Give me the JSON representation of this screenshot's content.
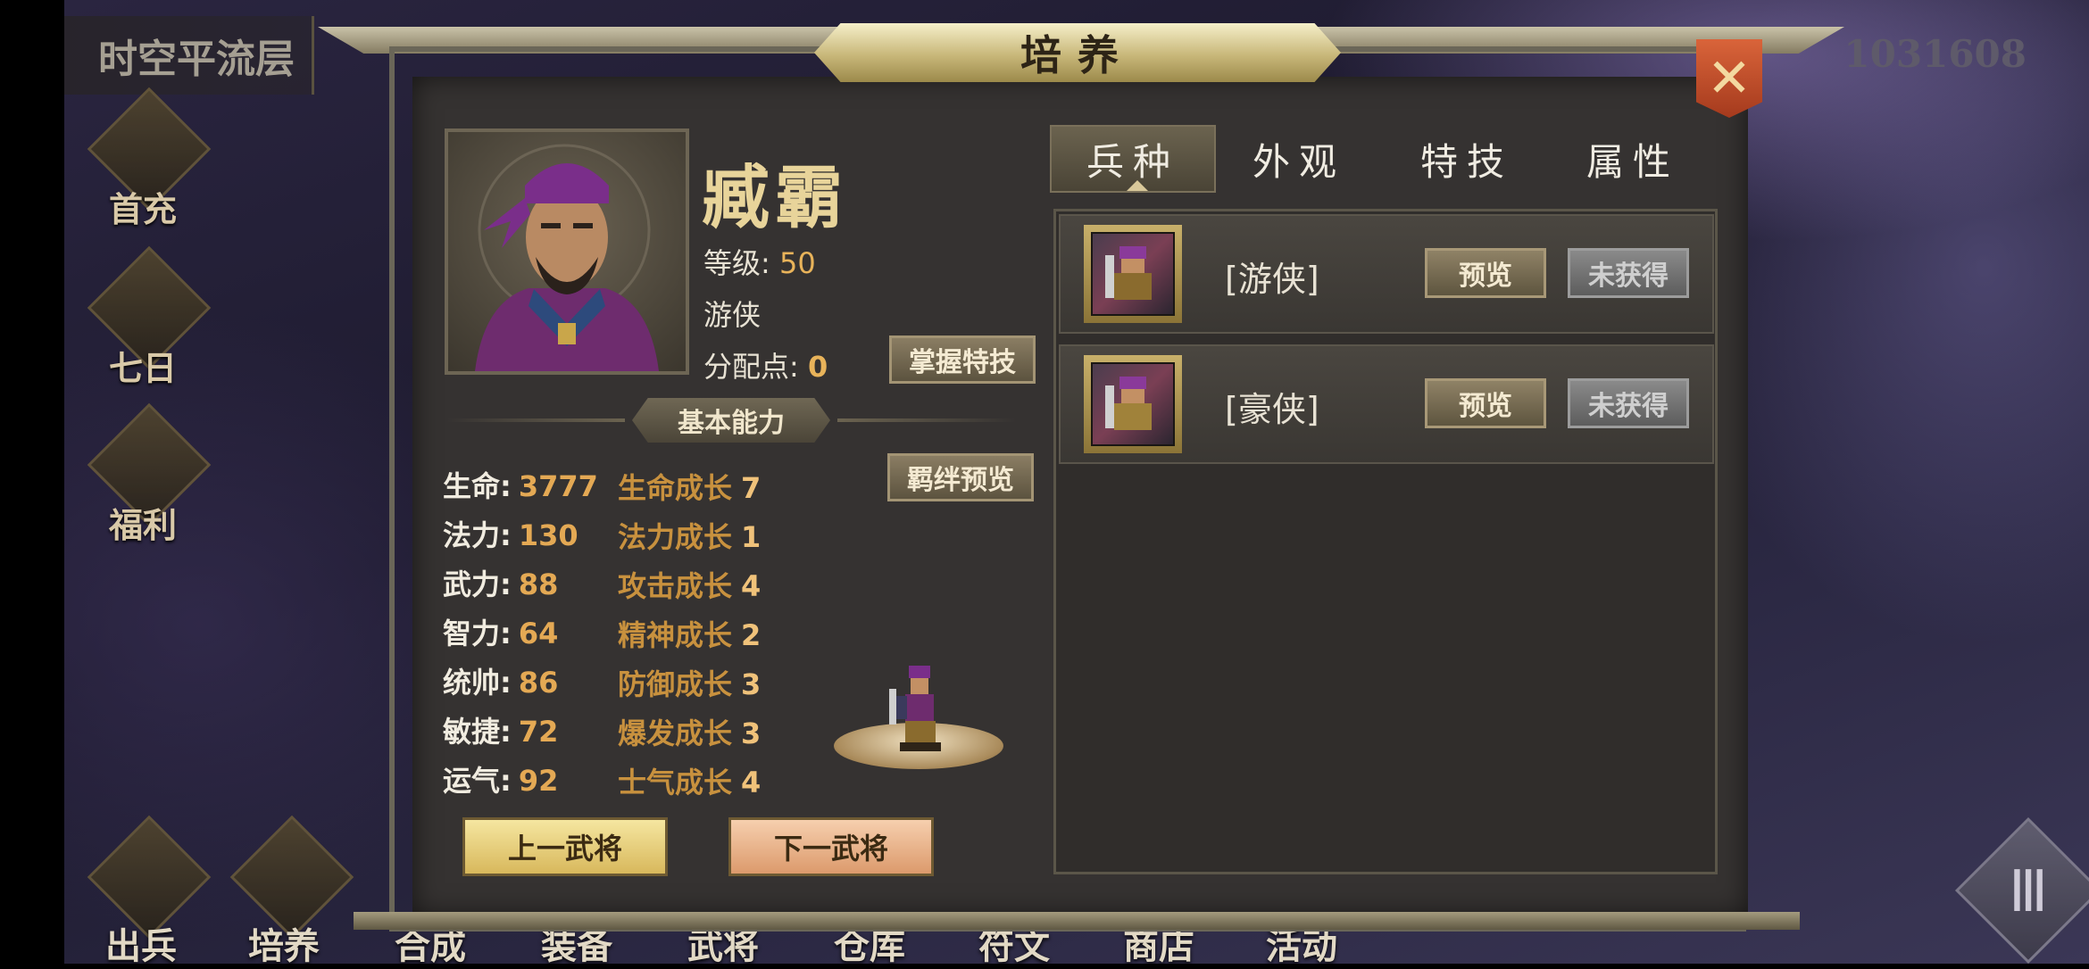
{
  "location": "时空平流层",
  "score": "1031608",
  "side_menu": [
    {
      "label": "首充",
      "icon": "gift-icon"
    },
    {
      "label": "七日",
      "icon": "scroll-icon"
    },
    {
      "label": "福利",
      "icon": "treasure-chest-icon"
    }
  ],
  "bottom_nav": [
    "出兵",
    "培养",
    "合成",
    "装备",
    "武将",
    "仓库",
    "符文",
    "商店",
    "活动"
  ],
  "dialog": {
    "title": "培养",
    "close_icon": "close-icon"
  },
  "hero": {
    "name": "臧霸",
    "level_label": "等级:",
    "level": "50",
    "class": "游侠",
    "points_label": "分配点:",
    "points": "0",
    "master_skill_button": "掌握特技",
    "bond_preview_button": "羁绊预览",
    "section_title": "基本能力",
    "stats": [
      {
        "label": "生命:",
        "value": "3777"
      },
      {
        "label": "法力:",
        "value": "130"
      },
      {
        "label": "武力:",
        "value": "88"
      },
      {
        "label": "智力:",
        "value": "64"
      },
      {
        "label": "统帅:",
        "value": "86"
      },
      {
        "label": "敏捷:",
        "value": "72"
      },
      {
        "label": "运气:",
        "value": "92"
      }
    ],
    "growth": [
      {
        "label": "生命成长",
        "value": "7"
      },
      {
        "label": "法力成长",
        "value": "1"
      },
      {
        "label": "攻击成长",
        "value": "4"
      },
      {
        "label": "精神成长",
        "value": "2"
      },
      {
        "label": "防御成长",
        "value": "3"
      },
      {
        "label": "爆发成长",
        "value": "3"
      },
      {
        "label": "士气成长",
        "value": "4"
      }
    ],
    "prev_button": "上一武将",
    "next_button": "下一武将"
  },
  "tabs": [
    "兵种",
    "外观",
    "特技",
    "属性"
  ],
  "active_tab": "兵种",
  "units": [
    {
      "name": "[游侠]",
      "preview": "预览",
      "status": "未获得"
    },
    {
      "name": "[豪侠]",
      "preview": "预览",
      "status": "未获得"
    }
  ],
  "colors": {
    "accent_gold": "#e4a954",
    "growth_label": "#c8913e",
    "panel_bg": "#353231",
    "close_red": "#c24e2b"
  }
}
